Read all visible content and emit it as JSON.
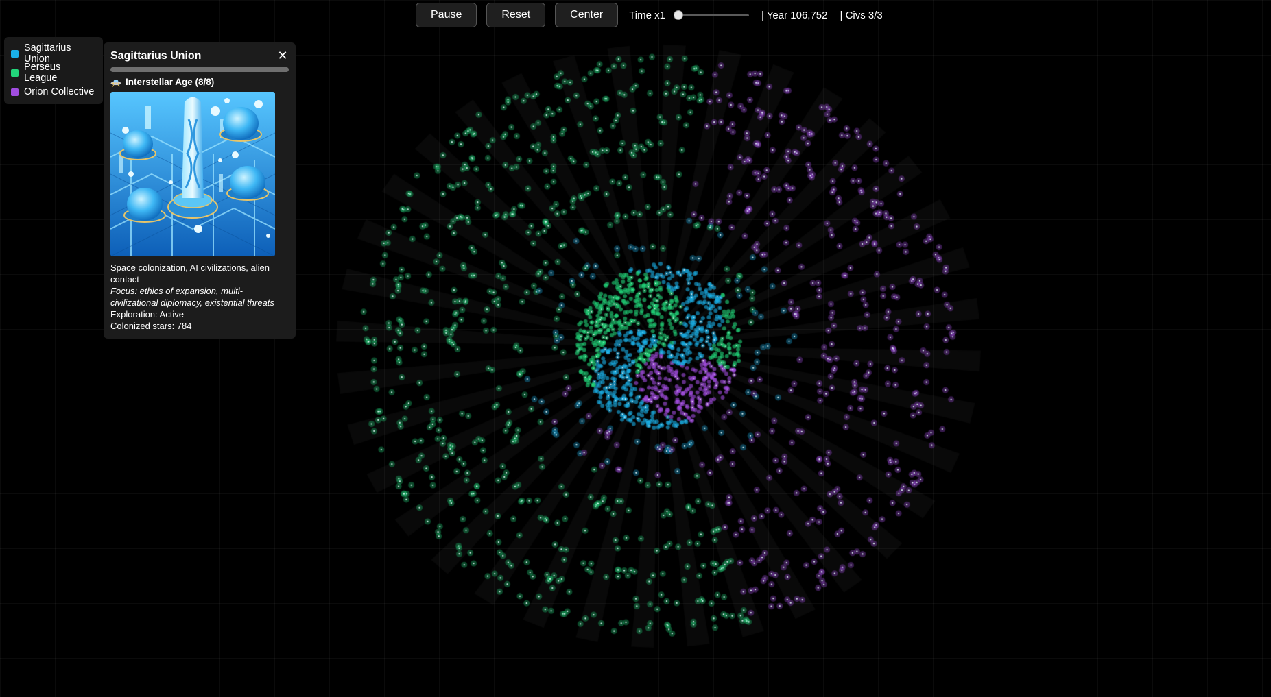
{
  "toolbar": {
    "pause_label": "Pause",
    "reset_label": "Reset",
    "center_label": "Center",
    "time_label": "Time x1",
    "time_speed": 1,
    "time_speed_max": 10,
    "year_text": "| Year 106,752",
    "civs_text": "| Civs 3/3"
  },
  "legend": {
    "items": [
      {
        "label": "Sagittarius Union",
        "color": "#1ab0e8"
      },
      {
        "label": "Perseus League",
        "color": "#22d57a"
      },
      {
        "label": "Orion Collective",
        "color": "#a14de0"
      }
    ]
  },
  "panel": {
    "title": "Sagittarius Union",
    "close_icon": "close-icon",
    "progress_fraction": 1.0,
    "age_icon": "ufo-icon",
    "age_text": "Interstellar Age (8/8)",
    "illustration": "futuristic-domed-city-illustration",
    "description": "Space colonization, AI civilizations, alien contact",
    "focus": "Focus: ethics of expansion, multi-civilizational diplomacy, existential threats",
    "exploration": "Exploration: Active",
    "colonized": "Colonized stars: 784"
  },
  "colors": {
    "background": "#000000",
    "sagittarius": "#1ab0e8",
    "perseus": "#22d57a",
    "orion": "#a14de0"
  }
}
